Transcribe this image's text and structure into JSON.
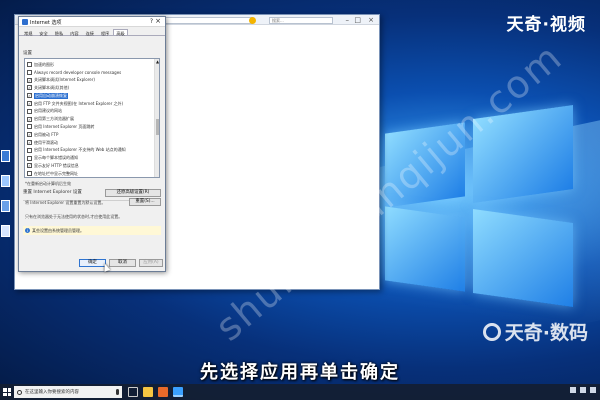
{
  "brand": {
    "top_logo": "天奇·视频",
    "bottom_logo": "天奇·数码",
    "watermark": "shuma.tianqijun.com"
  },
  "subtitle": "先选择应用再单击确定",
  "browser": {
    "search_placeholder": "搜索..."
  },
  "dialog": {
    "title": "Internet 选项",
    "help_glyph": "?",
    "close_glyph": "×",
    "tabs": [
      "常规",
      "安全",
      "隐私",
      "内容",
      "连接",
      "程序",
      "高级"
    ],
    "active_tab_index": 6,
    "settings_heading": "设置",
    "settings_items": [
      {
        "label": "加速的图形",
        "checked": false,
        "selected": false
      },
      {
        "label": "Always record developer console messages",
        "checked": false,
        "selected": false
      },
      {
        "label": "关闭脚本调试(Internet Explorer)",
        "checked": true,
        "selected": false
      },
      {
        "label": "关闭脚本调试(其他)",
        "checked": true,
        "selected": false
      },
      {
        "label": "启用自动崩溃恢复",
        "checked": true,
        "selected": true
      },
      {
        "label": "启用 FTP 文件夹视图(在 Internet Explorer 之外)",
        "checked": true,
        "selected": false
      },
      {
        "label": "启用建议的网站",
        "checked": false,
        "selected": false
      },
      {
        "label": "启用第三方浏览器扩展",
        "checked": true,
        "selected": false
      },
      {
        "label": "启用 Internet Explorer 页面跳转",
        "checked": false,
        "selected": false
      },
      {
        "label": "启用被动 FTP",
        "checked": true,
        "selected": false
      },
      {
        "label": "使用平滑滚动",
        "checked": true,
        "selected": false
      },
      {
        "label": "启用 Internet Explorer 不支持的 Web 站点的通知",
        "checked": false,
        "selected": false
      },
      {
        "label": "显示每个脚本错误的通知",
        "checked": false,
        "selected": false
      },
      {
        "label": "显示友好 HTTP 错误信息",
        "checked": true,
        "selected": false
      },
      {
        "label": "在地址栏中显示完整网址",
        "checked": false,
        "selected": false
      }
    ],
    "restart_note": "*在重新启动计算机后生效",
    "restore_advanced_button": "还原高级设置(R)",
    "reset_heading": "重置 Internet Explorer 设置",
    "reset_desc": "将 Internet Explorer 设置重置为默认设置。",
    "reset_button": "重置(S)...",
    "reset_note": "只有在浏览器处于无法使用的状态时,才应使用此设置。",
    "warning_text": "某些设置由系统管理员管理。",
    "ok_button": "确定",
    "cancel_button": "取消",
    "apply_button": "应用(A)"
  },
  "taskbar": {
    "search_placeholder": "在这里输入你要搜索的内容"
  }
}
